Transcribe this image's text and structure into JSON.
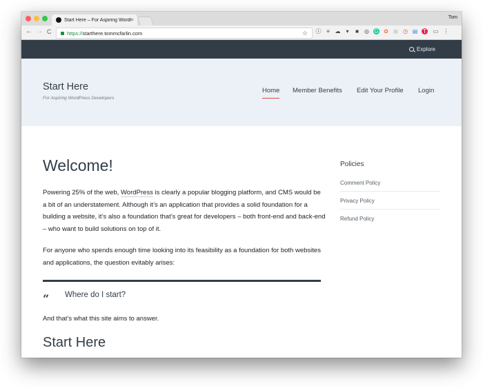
{
  "browser": {
    "tab_title": "Start Here – For Aspiring WordPress Developers",
    "tab_close": "×",
    "user_name": "Tom",
    "back": "←",
    "forward": "→",
    "reload": "C",
    "url_scheme": "https://",
    "url_host": "starthere.tommcfarlin.com",
    "bookmark_icon": "☆",
    "extensions": [
      "info-icon",
      "layers-icon",
      "cloud-icon",
      "pocket-icon",
      "evernote-icon",
      "speedometer-icon",
      "grammarly-icon",
      "honey-icon",
      "ghost-icon",
      "timer-icon",
      "onepassword-icon",
      "tampermonkey-icon",
      "tabs-icon",
      "menu-icon"
    ]
  },
  "site_bar": {
    "explore_label": "Explore"
  },
  "header": {
    "title": "Start Here",
    "tagline": "For Aspiring WordPress Developers",
    "nav": [
      {
        "label": "Home",
        "active": true
      },
      {
        "label": "Member Benefits"
      },
      {
        "label": "Edit Your Profile"
      },
      {
        "label": "Login"
      }
    ],
    "accent_color": "#e2453c"
  },
  "main": {
    "heading": "Welcome!",
    "p1_before": "Powering 25% of the web, ",
    "p1_link": "WordPress",
    "p1_after": " is clearly a popular blogging platform, and CMS would be a bit of an understatement. Although it’s an application that provides a solid foundation for a building a website, it’s also a foundation that’s great for developers – both front-end and back-end – who want to build solutions on top of it.",
    "p2": "For anyone who spends enough time looking into its feasibility as a foundation for both websites and applications, the question evitably arises:",
    "quote_mark": "“",
    "quote": "Where do I start?",
    "p3": "And that’s what this site aims to answer.",
    "subheading": "Start Here"
  },
  "sidebar": {
    "title": "Policies",
    "items": [
      "Comment Policy",
      "Privacy Policy",
      "Refund Policy"
    ]
  }
}
